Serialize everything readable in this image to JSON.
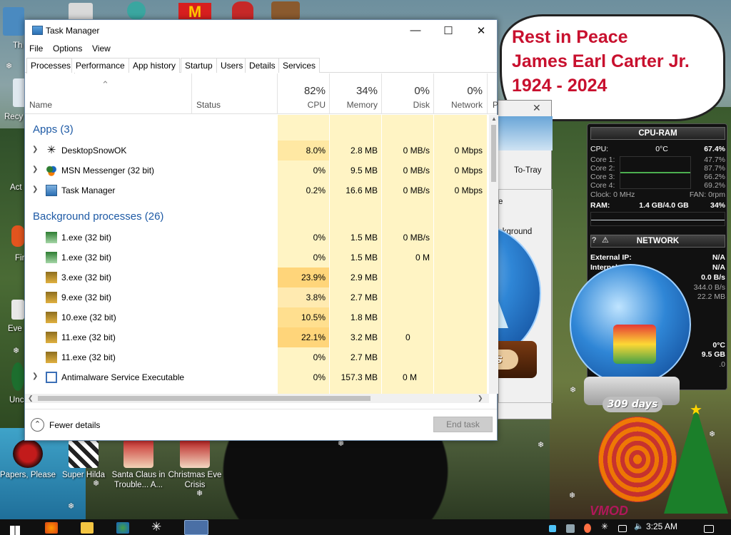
{
  "desktop": {
    "icons": [
      {
        "label": "Papers, Please"
      },
      {
        "label": "Super Hilda"
      },
      {
        "label": "Santa Claus in Trouble... A..."
      },
      {
        "label": "Christmas Eve Crisis"
      }
    ],
    "left_labels": [
      "Th",
      "Recy",
      "Act",
      "Fir",
      "Eve",
      "Unc"
    ],
    "banner": {
      "line1": "Rest in Peace",
      "line2": "James Earl Carter Jr.",
      "line3": "1924 - 2024"
    },
    "globe_days": "309 days"
  },
  "task_manager": {
    "title": "Task Manager",
    "menu": [
      "File",
      "Options",
      "View"
    ],
    "tabs": [
      "Processes",
      "Performance",
      "App history",
      "Startup",
      "Users",
      "Details",
      "Services"
    ],
    "columns": {
      "name": "Name",
      "status": "Status",
      "cpu_pct": "82%",
      "cpu": "CPU",
      "mem_pct": "34%",
      "mem": "Memory",
      "disk_pct": "0%",
      "disk": "Disk",
      "net_pct": "0%",
      "net": "Network",
      "extra": "P"
    },
    "groups": {
      "apps": "Apps (3)",
      "background": "Background processes (26)"
    },
    "apps": [
      {
        "name": "DesktopSnowOK",
        "cpu": "8.0%",
        "mem": "2.8 MB",
        "disk": "0 MB/s",
        "net": "0 Mbps"
      },
      {
        "name": "MSN Messenger (32 bit)",
        "cpu": "0%",
        "mem": "9.5 MB",
        "disk": "0 MB/s",
        "net": "0 Mbps"
      },
      {
        "name": "Task Manager",
        "cpu": "0.2%",
        "mem": "16.6 MB",
        "disk": "0 MB/s",
        "net": "0 Mbps"
      }
    ],
    "background": [
      {
        "name": "1.exe (32 bit)",
        "cpu": "0%",
        "mem": "1.5 MB",
        "disk": "0 MB/s",
        "net": ""
      },
      {
        "name": "1.exe (32 bit)",
        "cpu": "0%",
        "mem": "1.5 MB",
        "disk": "0 M",
        "net": ""
      },
      {
        "name": "3.exe (32 bit)",
        "cpu": "23.9%",
        "mem": "2.9 MB",
        "disk": "",
        "net": ""
      },
      {
        "name": "9.exe (32 bit)",
        "cpu": "3.8%",
        "mem": "2.7 MB",
        "disk": "",
        "net": ""
      },
      {
        "name": "10.exe (32 bit)",
        "cpu": "10.5%",
        "mem": "1.8 MB",
        "disk": "",
        "net": ""
      },
      {
        "name": "11.exe (32 bit)",
        "cpu": "22.1%",
        "mem": "3.2 MB",
        "disk": "0",
        "net": ""
      },
      {
        "name": "11.exe (32 bit)",
        "cpu": "0%",
        "mem": "2.7 MB",
        "disk": "",
        "net": ""
      },
      {
        "name": "Antimalware Service Executable",
        "cpu": "0%",
        "mem": "157.3 MB",
        "disk": "0 M",
        "net": ""
      }
    ],
    "footer": {
      "fewer": "Fewer details",
      "end_task": "End task"
    }
  },
  "behind_window": {
    "totray": "To-Tray",
    "e": "e",
    "background": "ckground"
  },
  "widget": {
    "cpu_title": "CPU-RAM",
    "cpu": {
      "label": "CPU:",
      "temp": "0°C",
      "value": "67.4%"
    },
    "cores": [
      {
        "label": "Core 1:",
        "value": "47.7%"
      },
      {
        "label": "Core 2:",
        "value": "87.7%"
      },
      {
        "label": "Core 3:",
        "value": "66.2%"
      },
      {
        "label": "Core 4:",
        "value": "69.2%"
      }
    ],
    "clock": "Clock: 0 MHz",
    "fan": "FAN: 0rpm",
    "ram": {
      "label": "RAM:",
      "value": "1.4 GB/4.0 GB",
      "pct": "34%"
    },
    "net_title": "NETWORK",
    "ext_ip": {
      "label": "External IP:",
      "value": "N/A"
    },
    "internal": {
      "label": "Internal",
      "value": "N/A"
    },
    "rates": [
      "0.0 B/s",
      "344.0 B/s",
      "22.2 MB"
    ],
    "temp2": "0°C",
    "mem2": "9.5 GB",
    "misc": ".0"
  },
  "taskbar": {
    "time": "3:25 AM"
  }
}
